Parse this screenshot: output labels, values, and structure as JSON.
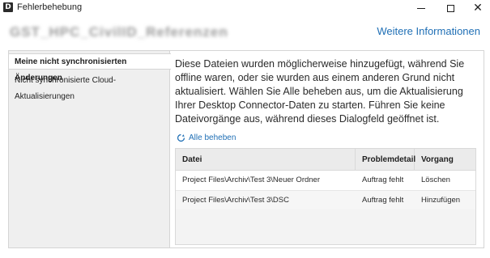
{
  "window": {
    "title": "Fehlerbehebung",
    "icon_label": "D",
    "controls": {
      "minimize": "minimize-icon",
      "maximize": "maximize-icon",
      "close": "close-icon",
      "close_glyph": "✕"
    }
  },
  "header": {
    "project_name": "GST_HPC_CivilID_Referenzen",
    "more_info_link": "Weitere Informationen"
  },
  "sidebar": {
    "items": [
      {
        "label": "Meine nicht synchronisierten Änderungen",
        "active": true
      },
      {
        "label": "Nicht synchronisierte Cloud-Aktualisierungen",
        "active": false
      }
    ]
  },
  "main": {
    "description": "Diese Dateien wurden möglicherweise hinzugefügt, während Sie offline waren, oder sie wurden aus einem anderen Grund nicht aktualisiert. Wählen Sie Alle beheben aus, um die Aktualisierung Ihrer Desktop Connector-Daten zu starten. Führen Sie keine Dateivorgänge aus, während dieses Dialogfeld geöffnet ist.",
    "fix_all_label": "Alle beheben",
    "table": {
      "headers": [
        "Datei",
        "Problemdetail",
        "Vorgang"
      ],
      "rows": [
        [
          "Project Files\\Archiv\\Test 3\\Neuer Ordner",
          "Auftrag fehlt",
          "Löschen"
        ],
        [
          "Project Files\\Archiv\\Test 3\\DSC",
          "Auftrag fehlt",
          "Hinzufügen"
        ]
      ]
    }
  },
  "colors": {
    "link": "#1f6fb5",
    "sidebar_bg": "#efefef"
  }
}
